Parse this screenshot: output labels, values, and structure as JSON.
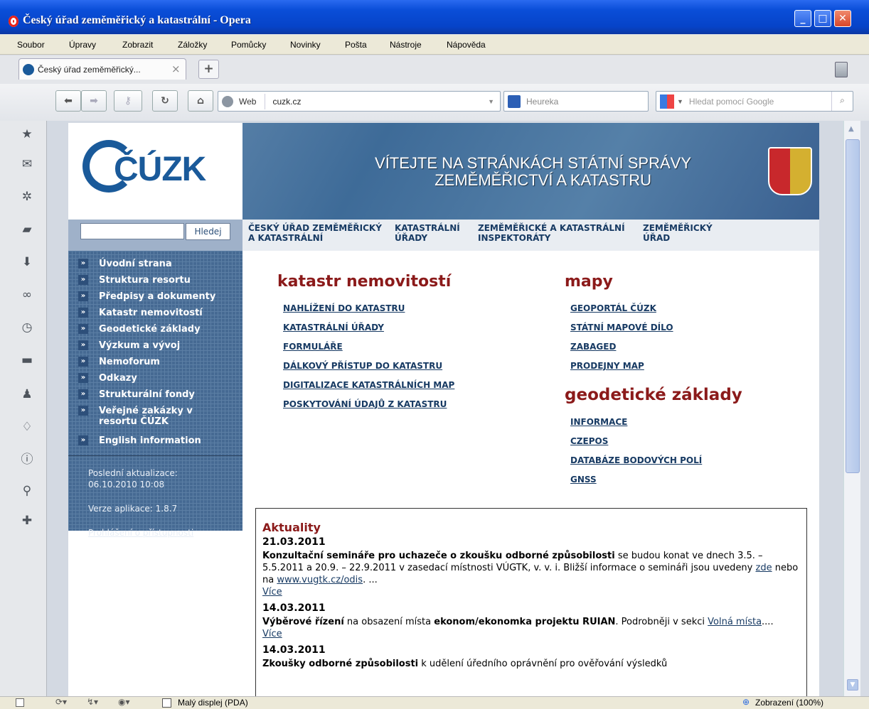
{
  "window": {
    "title": "Český úřad zeměměřický a katastrální - Opera"
  },
  "menubar": [
    "Soubor",
    "Úpravy",
    "Zobrazit",
    "Záložky",
    "Pomůcky",
    "Novinky",
    "Pošta",
    "Nástroje",
    "Nápověda"
  ],
  "tab": {
    "label": "Český úřad zeměměřický...",
    "close": "×",
    "new": "+"
  },
  "toolbar": {
    "web_label": "Web",
    "address": "cuzk.cz",
    "search_engine": "Heureka",
    "google_placeholder": "Hledat pomocí Google"
  },
  "statusbar": {
    "pda_label": "Malý displej (PDA)",
    "zoom": "Zobrazení (100%)"
  },
  "site": {
    "logo_text": "ČÚZK",
    "banner_line1": "VÍTEJTE NA STRÁNKÁCH STÁTNÍ SPRÁVY",
    "banner_line2": "ZEMĚMĚŘICTVÍ A KATASTRU",
    "search_button": "Hledej",
    "nav": [
      "ČESKÝ ÚŘAD ZEMĚMĚŘICKÝ A KATASTRÁLNÍ",
      "KATASTRÁLNÍ ÚŘADY",
      "ZEMĚMĚŘICKÉ A KATASTRÁLNÍ INSPEKTORÁTY",
      "ZEMĚMĚŘICKÝ ÚŘAD"
    ],
    "leftnav": [
      "Úvodní strana",
      "Struktura resortu",
      "Předpisy a dokumenty",
      "Katastr nemovitostí",
      "Geodetické základy",
      "Výzkum a vývoj",
      "Nemoforum",
      "Odkazy",
      "Strukturální fondy",
      "Veřejné zakázky v resortu ČÚZK",
      "English information"
    ],
    "last_update_label": "Poslední aktualizace:",
    "last_update_value": "06.10.2010 10:08",
    "version": "Verze aplikace: 1.8.7",
    "accessibility": "Prohlášení o přístupnosti",
    "katastr_heading": "katastr nemovitostí",
    "katastr_links": [
      "NAHLÍŽENÍ DO KATASTRU",
      "KATASTRÁLNÍ ÚŘADY",
      "FORMULÁŘE",
      "DÁLKOVÝ PŘÍSTUP DO KATASTRU",
      "DIGITALIZACE KATASTRÁLNÍCH MAP",
      "POSKYTOVÁNÍ ÚDAJŮ Z KATASTRU"
    ],
    "mapy_heading": "mapy",
    "mapy_links": [
      "GEOPORTÁL ČÚZK",
      "STÁTNÍ MAPOVÉ DÍLO",
      "ZABAGED",
      "PRODEJNY MAP"
    ],
    "geo_heading": "geodetické základy",
    "geo_links": [
      "INFORMACE",
      "CZEPOS",
      "DATABÁZE BODOVÝCH POLÍ",
      "GNSS"
    ],
    "news": {
      "title": "Aktuality",
      "more": "Více",
      "items": [
        {
          "date": "21.03.2011",
          "bold": "Konzultační semináře pro uchazeče o zkoušku odborné způsobilosti",
          "text1": " se budou konat ve dnech 3.5. – 5.5.2011 a 20.9. – 22.9.2011 v zasedací místnosti VÚGTK, v. v. i. Bližší informace o semináři jsou uvedeny ",
          "link1": "zde",
          "text2": " nebo na ",
          "link2": "www.vugtk.cz/odis",
          "text3": ". ..."
        },
        {
          "date": "14.03.2011",
          "bold": "Výběrové řízení",
          "text1": " na obsazení místa ",
          "bold2": "ekonom/ekonomka projektu RUIAN",
          "text2": ". Podrobněji v sekci ",
          "link1": "Volná místa",
          "text3": "...."
        },
        {
          "date": "14.03.2011",
          "bold": "Zkoušky odborné způsobilosti",
          "text1": " k udělení úředního oprávnění pro ověřování výsledků"
        }
      ]
    }
  }
}
